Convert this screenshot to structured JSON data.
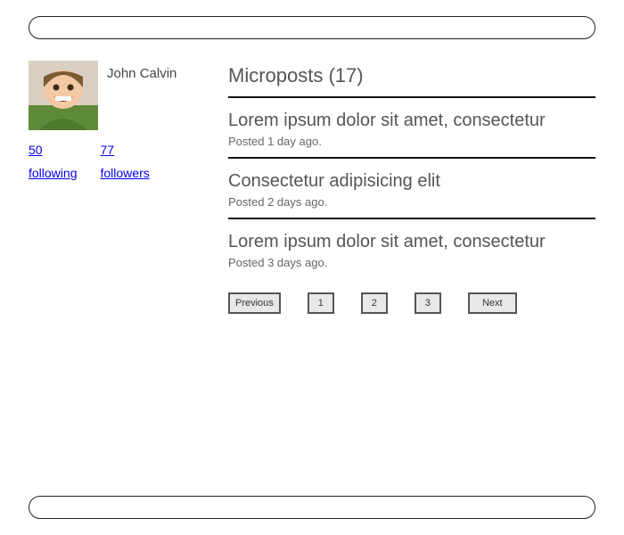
{
  "user": {
    "name": "John Calvin",
    "following_count": "50",
    "following_label": "following",
    "followers_count": "77",
    "followers_label": "followers"
  },
  "feed": {
    "title": "Microposts (17)",
    "posts": [
      {
        "text": "Lorem ipsum dolor sit amet, consectetur",
        "meta": "Posted 1 day ago."
      },
      {
        "text": "Consectetur adipisicing elit",
        "meta": "Posted 2 days ago."
      },
      {
        "text": "Lorem ipsum dolor sit amet, consectetur",
        "meta": "Posted 3 days ago."
      }
    ]
  },
  "pagination": {
    "prev": "Previous",
    "pages": [
      "1",
      "2",
      "3"
    ],
    "next": "Next"
  }
}
